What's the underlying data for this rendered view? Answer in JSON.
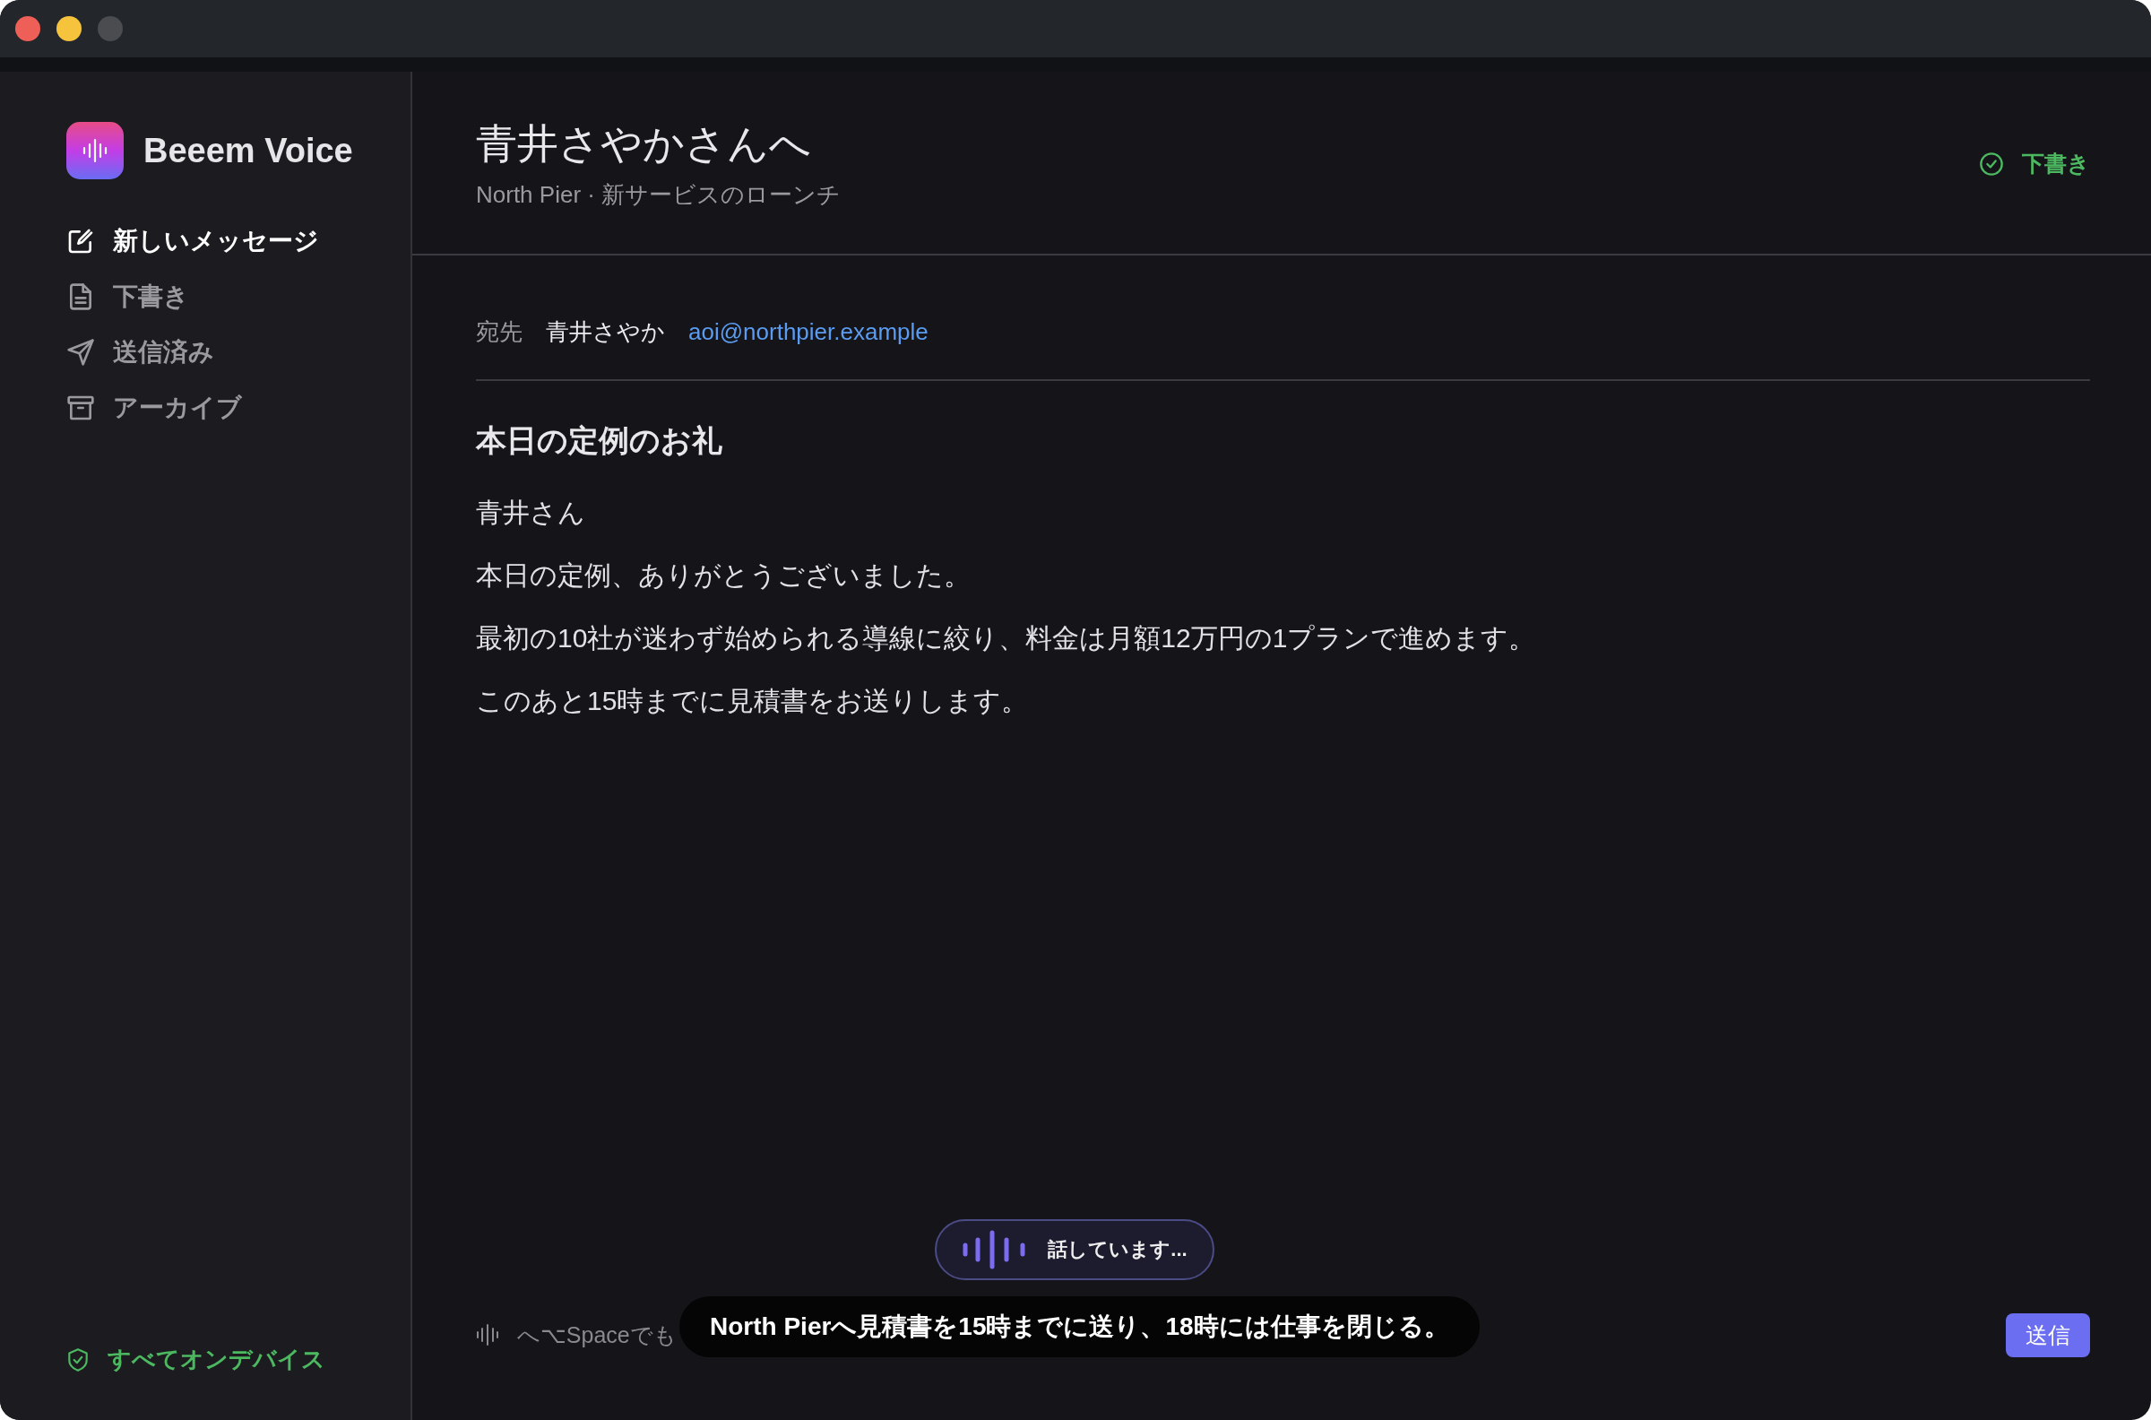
{
  "app": {
    "name": "Beeem Voice"
  },
  "nav": [
    {
      "label": "新しいメッセージ",
      "kind": "compose",
      "selected": true
    },
    {
      "label": "下書き",
      "kind": "document",
      "selected": false
    },
    {
      "label": "送信済み",
      "kind": "send",
      "selected": false
    },
    {
      "label": "アーカイブ",
      "kind": "archive",
      "selected": false
    }
  ],
  "privacy": {
    "label": "すべてオンデバイス"
  },
  "header": {
    "title": "青井さやかさんへ",
    "subtitle": "North Pier · 新サービスのローンチ",
    "status": "下書き"
  },
  "recipient": {
    "label": "宛先",
    "name": "青井さやか",
    "email": "aoi@northpier.example"
  },
  "message": {
    "subject": "本日の定例のお礼",
    "body": [
      "青井さん",
      "本日の定例、ありがとうございました。",
      "最初の10社が迷わず始められる導線に絞り、料金は月額12万円の1プランで進めます。",
      "このあと15時までに見積書をお送りします。"
    ]
  },
  "voice": {
    "status": "話しています...",
    "hint": "へ⌥Spaceでも",
    "caption": "North Pierへ見積書を15時までに送り、18時には仕事を閉じる。"
  },
  "send_button": "送信"
}
